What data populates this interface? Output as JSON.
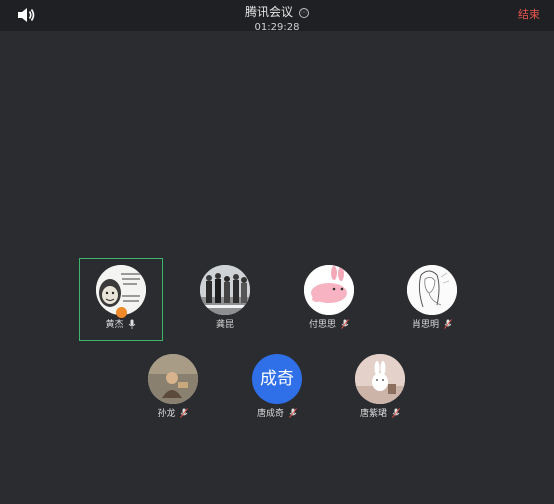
{
  "header": {
    "title": "腾讯会议",
    "timer": "01:29:28",
    "end_label": "结束",
    "info_icon": "ⓘ"
  },
  "participants": [
    {
      "name": "黄杰",
      "avatar": "meme-text-avatar",
      "mic": "mic-on",
      "active": true
    },
    {
      "name": "龚昆",
      "avatar": "crowd-photo-avatar",
      "mic": "none"
    },
    {
      "name": "付思思",
      "avatar": "pink-rabbit-avatar",
      "mic": "mic-muted"
    },
    {
      "name": "肖思明",
      "avatar": "sketch-girl-avatar",
      "mic": "mic-muted"
    },
    {
      "name": "孙龙",
      "avatar": "photo-avatar",
      "mic": "mic-muted"
    },
    {
      "name": "唐成奇",
      "avatar": "text-avatar",
      "avatar_text": "成奇",
      "mic": "mic-muted"
    },
    {
      "name": "唐紫珺",
      "avatar": "bunny-avatar",
      "mic": "mic-muted"
    }
  ],
  "colors": {
    "background": "#2b2c30",
    "topbar": "#1f2023",
    "end_red": "#e8554e",
    "active_green": "#3fb56b",
    "text_avatar_blue": "#2f6fe8"
  }
}
